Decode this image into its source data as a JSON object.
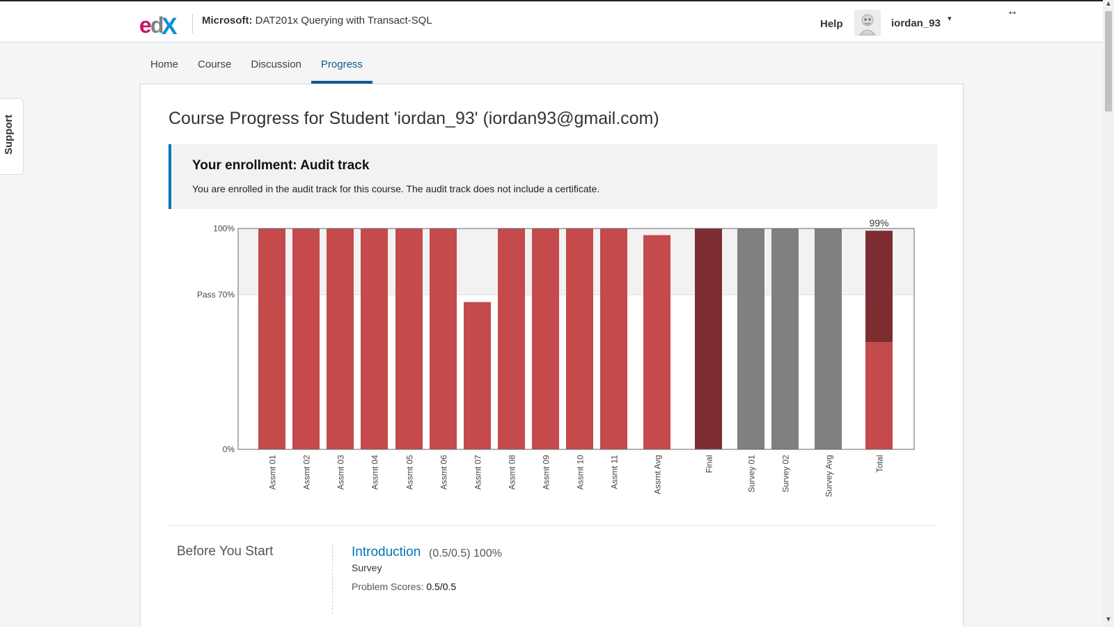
{
  "header": {
    "course_org": "Microsoft:",
    "course_name": "DAT201x Querying with Transact-SQL",
    "help": "Help",
    "username": "iordan_93",
    "logo_icon": "edx-logo",
    "caret_glyph": "▾",
    "resize_glyph": "↔"
  },
  "nav": {
    "tabs": [
      "Home",
      "Course",
      "Discussion",
      "Progress"
    ],
    "active": "Progress"
  },
  "support_label": "Support",
  "main": {
    "title": "Course Progress for Student 'iordan_93' (iordan93@gmail.com)",
    "enrollment_title": "Your enrollment: Audit track",
    "enrollment_message": "You are enrolled in the audit track for this course. The audit track does not include a certificate."
  },
  "chart_data": {
    "type": "bar",
    "y_ticks": [
      "100%",
      "Pass 70%",
      "0%"
    ],
    "ylim": [
      0,
      100
    ],
    "pass_line": 70,
    "categories": [
      "Assmt 01",
      "Assmt 02",
      "Assmt 03",
      "Assmt 04",
      "Assmt 05",
      "Assmt 06",
      "Assmt 07",
      "Assmt 08",
      "Assmt 09",
      "Assmt 10",
      "Assmt 11",
      "Assmt Avg",
      "Final",
      "Survey 01",
      "Survey 02",
      "Survey Avg",
      "Total"
    ],
    "values": [
      100,
      100,
      100,
      100,
      100,
      100,
      66.7,
      100,
      100,
      100,
      100,
      97,
      100,
      100,
      100,
      100,
      99
    ],
    "groups": [
      "assessment",
      "assessment",
      "assessment",
      "assessment",
      "assessment",
      "assessment",
      "assessment",
      "assessment",
      "assessment",
      "assessment",
      "assessment",
      "assessment",
      "final",
      "survey",
      "survey",
      "survey",
      "total"
    ],
    "total_segments": [
      48.5,
      50.5
    ],
    "total_label": "99%",
    "colors": {
      "assessment": "#c54a4c",
      "final": "#7d2d31",
      "survey": "#808080",
      "total_bottom": "#c54a4c",
      "total_top": "#7d2d31",
      "pass_band": "#f2f2f2"
    }
  },
  "sections": [
    {
      "chapter": "Before You Start",
      "name": "Introduction",
      "score": "(0.5/0.5) 100%",
      "format": "Survey",
      "problem_scores_label": "Problem Scores:",
      "problem_scores": "0.5/0.5"
    }
  ]
}
